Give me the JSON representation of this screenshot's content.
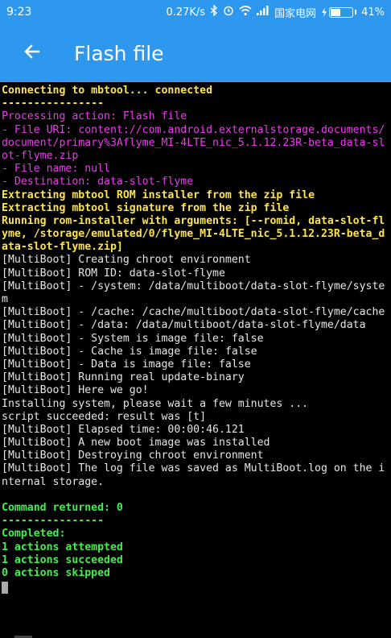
{
  "status_bar": {
    "time": "9:23",
    "network_speed": "0.27K/s",
    "carrier": "国家电网",
    "battery_percent": "41%",
    "battery_level": 0.41
  },
  "app_bar": {
    "title": "Flash file",
    "back_icon": "arrow-left-icon",
    "color": "#2e97ee"
  },
  "console": {
    "lines": [
      {
        "text": "Connecting to mbtool... connected",
        "color": "yellow"
      },
      {
        "text": "----------------",
        "color": "yellow"
      },
      {
        "text": "Processing action: Flash file",
        "color": "magenta"
      },
      {
        "text": "- File URI: content://com.android.externalstorage.documents/",
        "color": "magenta"
      },
      {
        "text": "document/primary%3Aflyme_MI-4LTE_nic_5.1.12.23R-beta_data-sl",
        "color": "magenta"
      },
      {
        "text": "ot-flyme.zip",
        "color": "magenta"
      },
      {
        "text": "- File name: null",
        "color": "magenta"
      },
      {
        "text": "- Destination: data-slot-flyme",
        "color": "magenta"
      },
      {
        "text": "Extracting mbtool ROM installer from the zip file",
        "color": "yellow"
      },
      {
        "text": "Extracting mbtool signature from the zip file",
        "color": "yellow"
      },
      {
        "text": "Running rom-installer with arguments: [--romid, data-slot-fl",
        "color": "yellow"
      },
      {
        "text": "yme, /storage/emulated/0/flyme_MI-4LTE_nic_5.1.12.23R-beta_d",
        "color": "yellow"
      },
      {
        "text": "ata-slot-flyme.zip]",
        "color": "yellow"
      },
      {
        "text": "[MultiBoot] Creating chroot environment",
        "color": "white"
      },
      {
        "text": "[MultiBoot] ROM ID: data-slot-flyme",
        "color": "white"
      },
      {
        "text": "[MultiBoot] - /system: /data/multiboot/data-slot-flyme/syste",
        "color": "white"
      },
      {
        "text": "m",
        "color": "white"
      },
      {
        "text": "[MultiBoot] - /cache: /cache/multiboot/data-slot-flyme/cache",
        "color": "white"
      },
      {
        "text": "[MultiBoot] - /data: /data/multiboot/data-slot-flyme/data",
        "color": "white"
      },
      {
        "text": "[MultiBoot] - System is image file: false",
        "color": "white"
      },
      {
        "text": "[MultiBoot] - Cache is image file: false",
        "color": "white"
      },
      {
        "text": "[MultiBoot] - Data is image file: false",
        "color": "white"
      },
      {
        "text": "[MultiBoot] Running real update-binary",
        "color": "white"
      },
      {
        "text": "[MultiBoot] Here we go!",
        "color": "white"
      },
      {
        "text": "Installing system, please wait a few minutes ...",
        "color": "white"
      },
      {
        "text": "script succeeded: result was [t]",
        "color": "white"
      },
      {
        "text": "[MultiBoot] Elapsed time: 00:00:46.121",
        "color": "white"
      },
      {
        "text": "[MultiBoot] A new boot image was installed",
        "color": "white"
      },
      {
        "text": "[MultiBoot] Destroying chroot environment",
        "color": "white"
      },
      {
        "text": "[MultiBoot] The log file was saved as MultiBoot.log on the i",
        "color": "white"
      },
      {
        "text": "nternal storage.",
        "color": "white"
      },
      {
        "text": "",
        "color": "white"
      },
      {
        "text": "Command returned: 0",
        "color": "green"
      },
      {
        "text": "----------------",
        "color": "green"
      },
      {
        "text": "Completed:",
        "color": "green"
      },
      {
        "text": "1 actions attempted",
        "color": "green"
      },
      {
        "text": "1 actions succeeded",
        "color": "green"
      },
      {
        "text": "0 actions skipped",
        "color": "green"
      }
    ]
  }
}
